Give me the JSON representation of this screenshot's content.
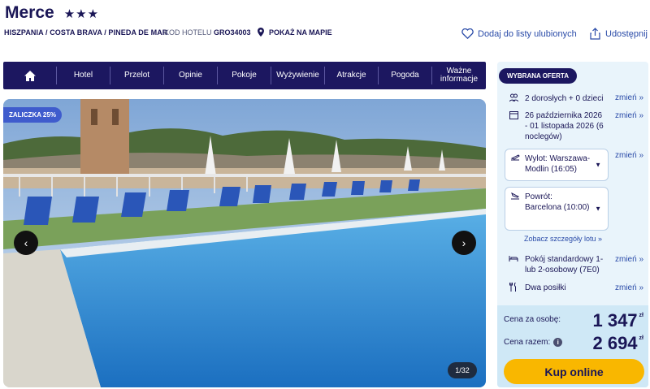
{
  "header": {
    "hotel_name": "Merce",
    "stars": "★★★",
    "breadcrumb": "HISZPANIA / COSTA BRAVA / PINEDA DE MAR",
    "code_label": "KOD HOTELU",
    "code_value": "GRO34003",
    "map_label": "POKAŻ NA MAPIE",
    "favorites_label": "Dodaj do listy ulubionych",
    "share_label": "Udostępnij"
  },
  "nav": {
    "items": [
      "Hotel",
      "Przelot",
      "Opinie",
      "Pokoje",
      "Wyżywienie",
      "Atrakcje",
      "Pogoda",
      "Ważne informacje"
    ]
  },
  "gallery": {
    "badge": "ZALICZKA 25%",
    "counter": "1/32"
  },
  "offer": {
    "title": "WYBRANA OFERTA",
    "change_label": "zmień »",
    "travelers": "2 dorosłych + 0 dzieci",
    "dates": "26 października 2026 - 01 listopada 2026 (6 noclegów)",
    "outbound": "Wylot: Warszawa-Modlin (16:05)",
    "return": "Powrót: Barcelona (10:00)",
    "flight_details": "Zobacz szczegóły lotu »",
    "room": "Pokój standardowy 1- lub 2-osobowy (7E0)",
    "board": "Dwa posiłki",
    "price_per_person_label": "Cena za osobę:",
    "price_per_person": "1 347",
    "price_total_label": "Cena razem:",
    "price_total": "2 694",
    "currency": "zł",
    "buy_label": "Kup online"
  },
  "colors": {
    "navy": "#1c1760",
    "accent_blue": "#2a4ba8",
    "badge_blue": "#3f5ccd",
    "button_yellow": "#f9b700",
    "panel_bg": "#e9f4fb"
  }
}
